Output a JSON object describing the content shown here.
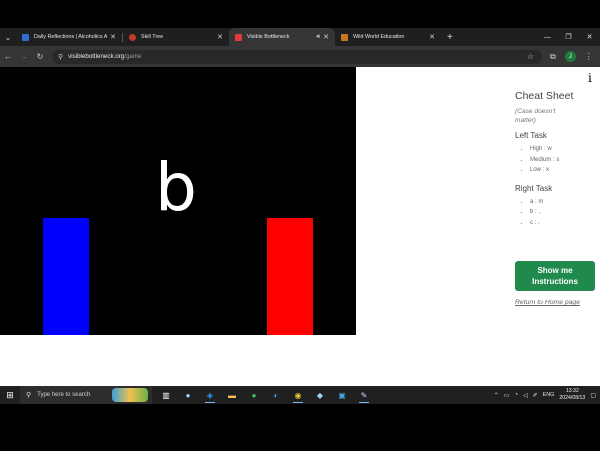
{
  "browser": {
    "tabs": [
      {
        "title": "Daily Reflections | Alcoholics Anonymous",
        "favicon_color": "#2f6fd1",
        "active": false
      },
      {
        "title": "Skill Tree",
        "favicon_color": "#c0392b",
        "active": false
      },
      {
        "title": "Visible Bottleneck",
        "favicon_color": "#e03a3a",
        "active": true
      },
      {
        "title": "Wild World Education",
        "favicon_color": "#c8781f",
        "active": false
      }
    ],
    "url_host": "visiblebottleneck.org",
    "url_path": "/game",
    "profile_initial": "J"
  },
  "game": {
    "letter": "b",
    "left_bar_color": "#0000ff",
    "right_bar_color": "#ff0000"
  },
  "sidebar": {
    "info": "i",
    "title": "Cheat Sheet",
    "note": "(Case doesn't matter)",
    "left_task": {
      "heading": "Left Task",
      "items": [
        "High : w",
        "Medium : s",
        "Low : x"
      ]
    },
    "right_task": {
      "heading": "Right Task",
      "items": [
        "a : m",
        "b : ,",
        "c : ."
      ]
    },
    "instructions_button": "Show me Instructions",
    "home_link": "Return to Home page"
  },
  "taskbar": {
    "search_placeholder": "Type here to search",
    "lang": "ENG",
    "time": "13:32",
    "date": "2024/08/13"
  }
}
